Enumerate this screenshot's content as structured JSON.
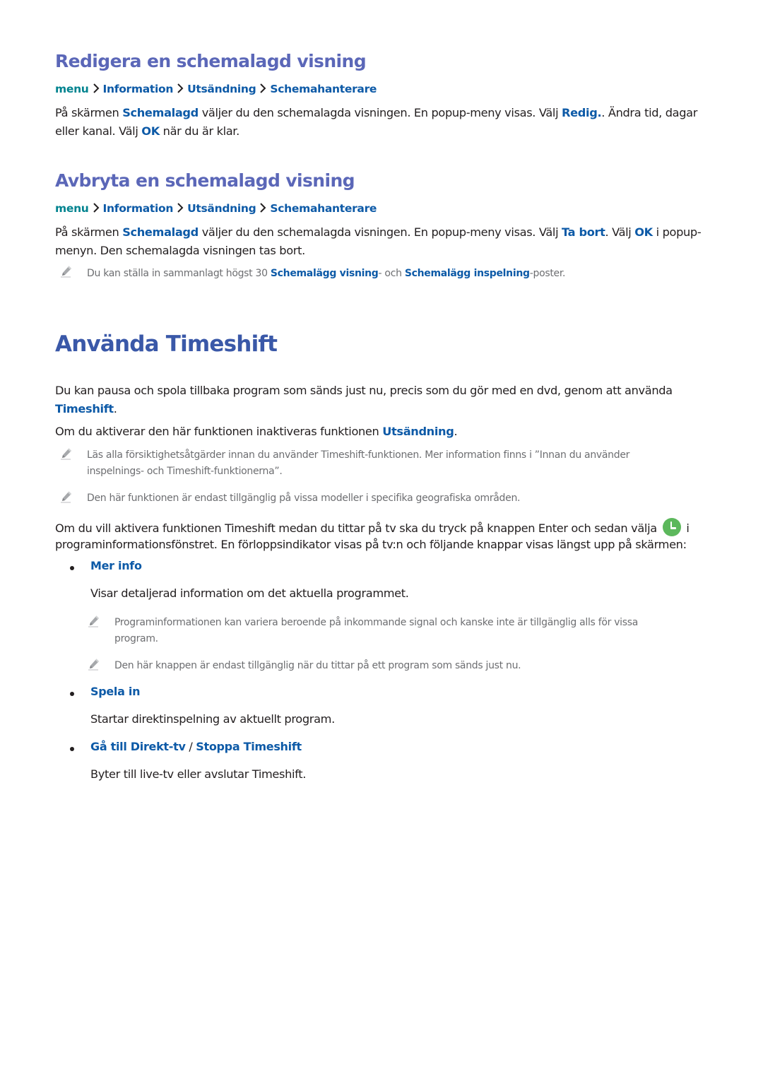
{
  "sections": {
    "edit": {
      "heading": "Redigera en schemalagd visning",
      "breadcrumb": [
        "menu",
        "Information",
        "Utsändning",
        "Schemahanterare"
      ],
      "paragraph": {
        "p1": "På skärmen ",
        "k1": "Schemalagd",
        "p2": " väljer du den schemalagda visningen. En popup-meny visas. Välj ",
        "k2": "Redig.",
        "p3": ". Ändra tid, dagar eller kanal. Välj ",
        "k3": "OK",
        "p4": " när du är klar."
      }
    },
    "cancel": {
      "heading": "Avbryta en schemalagd visning",
      "breadcrumb": [
        "menu",
        "Information",
        "Utsändning",
        "Schemahanterare"
      ],
      "paragraph": {
        "p1": "På skärmen ",
        "k1": "Schemalagd",
        "p2": " väljer du den schemalagda visningen. En popup-meny visas. Välj ",
        "k2": "Ta bort",
        "p3": ". Välj ",
        "k3": "OK",
        "p4": " i popup-menyn. Den schemalagda visningen tas bort."
      },
      "note": {
        "p1": "Du kan ställa in sammanlagt högst 30 ",
        "k1": "Schemalägg visning",
        "p2": "- och ",
        "k2": "Schemalägg inspelning",
        "p3": "-poster."
      }
    },
    "timeshift": {
      "heading": "Använda Timeshift",
      "intro": {
        "p1": "Du kan pausa och spola tillbaka program som sänds just nu, precis som du gör med en dvd, genom att använda ",
        "k1": "Timeshift",
        "p2": "."
      },
      "disable": {
        "p1": "Om du aktiverar den här funktionen inaktiveras funktionen ",
        "k1": "Utsändning",
        "p2": "."
      },
      "notes": [
        "Läs alla försiktighetsåtgärder innan du använder Timeshift-funktionen. Mer information finns i ”Innan du använder inspelnings- och Timeshift-funktionerna”.",
        "Den här funktionen är endast tillgänglig på vissa modeller i specifika geografiska områden."
      ],
      "activate": {
        "p1": "Om du vill aktivera funktionen Timeshift medan du tittar på tv ska du tryck på knappen Enter och sedan välja ",
        "icon": "timeshift-clock-icon",
        "p2": " i programinformationsfönstret. En förloppsindikator visas på tv:n och följande knappar visas längst upp på skärmen:"
      },
      "items": [
        {
          "title": "Mer info",
          "desc": "Visar detaljerad information om det aktuella programmet.",
          "notes": [
            "Programinformationen kan variera beroende på inkommande signal och kanske inte är tillgänglig alls för vissa program.",
            "Den här knappen är endast tillgänglig när du tittar på ett program som sänds just nu."
          ]
        },
        {
          "title": "Spela in",
          "desc": "Startar direktinspelning av aktuellt program."
        },
        {
          "title_a": "Gå till Direkt-tv",
          "title_sep": " / ",
          "title_b": "Stoppa Timeshift",
          "desc": "Byter till live-tv eller avslutar Timeshift."
        }
      ]
    }
  },
  "colors": {
    "heading_small": "#5b67b8",
    "heading_large": "#3a58a8",
    "keyword": "#0d5aa7",
    "menu": "#00838f",
    "note_text": "#6d6e71",
    "clock_icon": "#5cb85c"
  }
}
